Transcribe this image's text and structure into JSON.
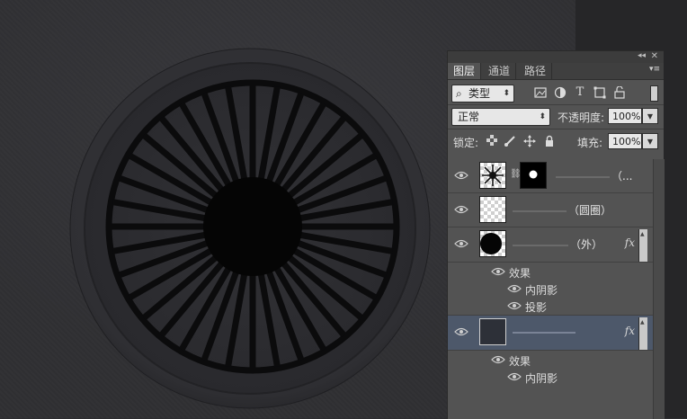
{
  "panel": {
    "tabs": [
      {
        "label": "图层",
        "active": true
      },
      {
        "label": "通道",
        "active": false
      },
      {
        "label": "路径",
        "active": false
      }
    ],
    "collapse_glyph": "◂◂",
    "close_glyph": "✕",
    "menu_glyph": "▾≡",
    "filter": {
      "glass_glyph": "⌕",
      "kind_label": "类型",
      "icon_names": [
        "image-filter-icon",
        "adjustment-filter-icon",
        "type-filter-icon",
        "shape-filter-icon",
        "smart-object-filter-icon"
      ]
    },
    "blend": {
      "mode": "正常",
      "opacity_label": "不透明度:",
      "opacity_value": "100%"
    },
    "lock": {
      "label": "锁定:",
      "fill_label": "填充:",
      "fill_value": "100%",
      "icon_names": [
        "lock-transparent-icon",
        "lock-pixels-icon",
        "lock-position-icon",
        "lock-all-icon"
      ]
    }
  },
  "layers": [
    {
      "name": "（...",
      "type": "masked",
      "selected": false
    },
    {
      "name": "（圆圈）",
      "type": "transparent",
      "selected": false
    },
    {
      "name": "（外）",
      "type": "circle",
      "selected": false,
      "fx": "fx",
      "effects_title": "效果",
      "effects": [
        "内阴影",
        "投影"
      ]
    },
    {
      "name": "",
      "type": "solid",
      "selected": true,
      "fx": "fx",
      "effects_title": "效果",
      "effects": [
        "内阴影"
      ]
    }
  ],
  "colors": {
    "panel_bg": "#535353",
    "selected_layer": "#4d586a",
    "canvas_bg": "#303033"
  }
}
